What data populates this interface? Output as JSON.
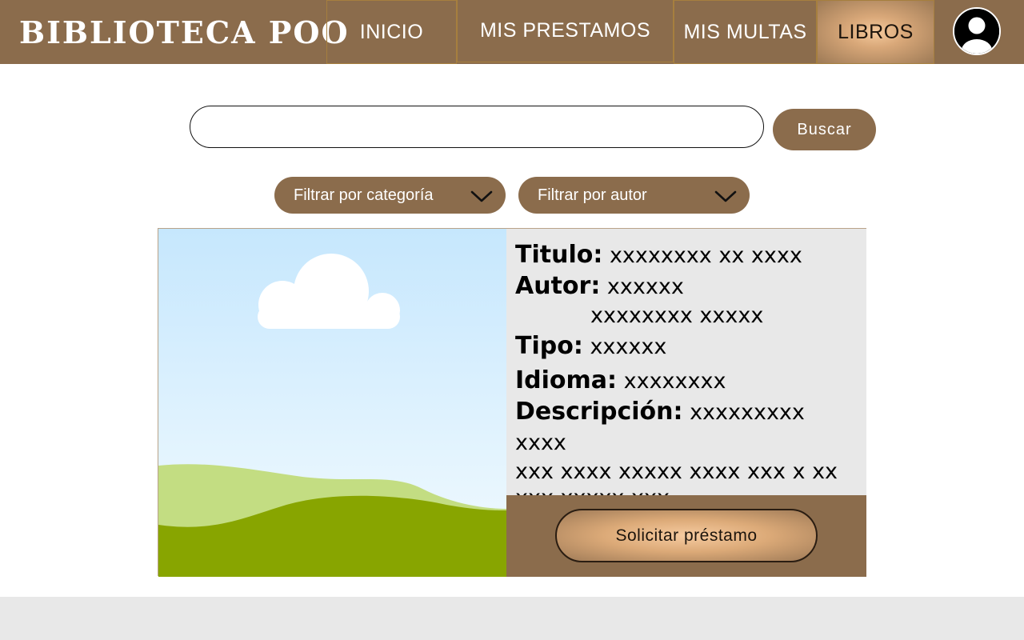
{
  "header": {
    "brand": "BIBLIOTECA POO",
    "nav": [
      {
        "label": "INICIO"
      },
      {
        "label": "MIS PRESTAMOS"
      },
      {
        "label": "MIS MULTAS"
      },
      {
        "label": "LIBROS",
        "active": true
      }
    ],
    "avatar_icon": "user-icon"
  },
  "search": {
    "value": "",
    "placeholder": "",
    "button_label": "Buscar"
  },
  "filters": [
    {
      "label": "Filtrar por categoría",
      "icon": "chevron-down-icon"
    },
    {
      "label": "Filtrar por autor",
      "icon": "chevron-down-icon"
    }
  ],
  "book": {
    "fields": {
      "titulo": {
        "label": "Titulo:",
        "value": "xxxxxxxx xx xxxx"
      },
      "autor": {
        "label": "Autor:",
        "value": "xxxxxx",
        "value2": "xxxxxxxx xxxxx"
      },
      "tipo": {
        "label": "Tipo:",
        "value": "xxxxxx"
      },
      "idioma": {
        "label": "Idioma:",
        "value": "xxxxxxxx"
      },
      "descripcion": {
        "label": "Descripción:",
        "line1": "xxxxxxxxx xxxx",
        "line2": "xxx xxxx xxxxx xxxx xxx x xx",
        "line3": "xxx xxxxx xxx"
      }
    },
    "image_icon": "landscape-placeholder-image",
    "request_label": "Solicitar préstamo"
  },
  "colors": {
    "brand_brown": "#8b6c4c",
    "panel_gray": "#e8e8e8",
    "accent_gold": "#f4c99c"
  }
}
